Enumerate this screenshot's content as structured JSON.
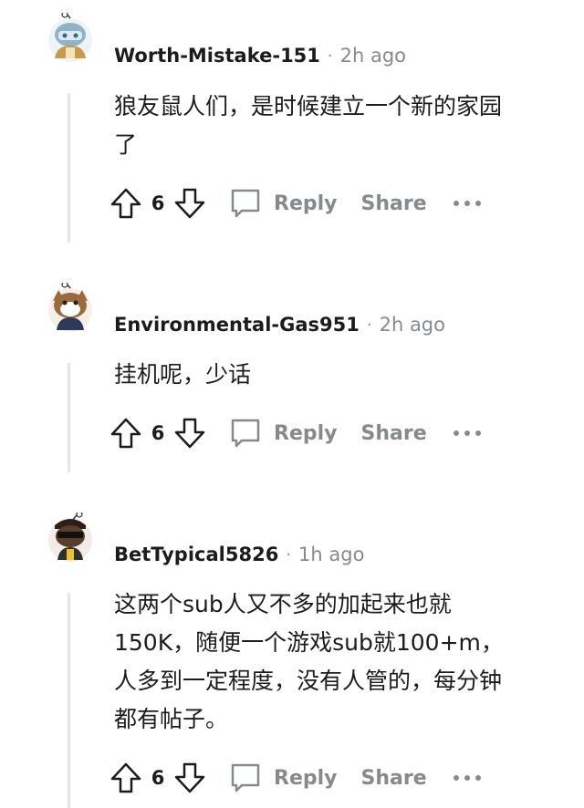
{
  "comments": [
    {
      "username": "Worth-Mistake-151",
      "separator": "·",
      "time": "2h ago",
      "body": "狼友鼠人们，是时候建立一个新的家园了",
      "score": "6",
      "reply_label": "Reply",
      "share_label": "Share",
      "avatar_icon": "reddit-snoo-avatar",
      "avatar_color": "#8fb3c9"
    },
    {
      "username": "Environmental-Gas951",
      "separator": "·",
      "time": "2h ago",
      "body": "挂机呢，少话",
      "score": "6",
      "reply_label": "Reply",
      "share_label": "Share",
      "avatar_icon": "reddit-snoo-avatar",
      "avatar_color": "#9a6a3c"
    },
    {
      "username": "BetTypical5826",
      "separator": "·",
      "time": "1h ago",
      "body": "这两个sub人又不多的加起来也就150K，随便一个游戏sub就100+m，人多到一定程度，没有人管的，每分钟都有帖子。",
      "score": "6",
      "reply_label": "Reply",
      "share_label": "Share",
      "avatar_icon": "reddit-snoo-avatar",
      "avatar_color": "#4a3a2a"
    }
  ],
  "colors": {
    "text": "#1c1c1c",
    "muted": "#878a8c",
    "thread_line": "#e5e5e5"
  },
  "icons": [
    "upvote-icon",
    "downvote-icon",
    "comment-bubble-icon",
    "more-options-icon"
  ]
}
